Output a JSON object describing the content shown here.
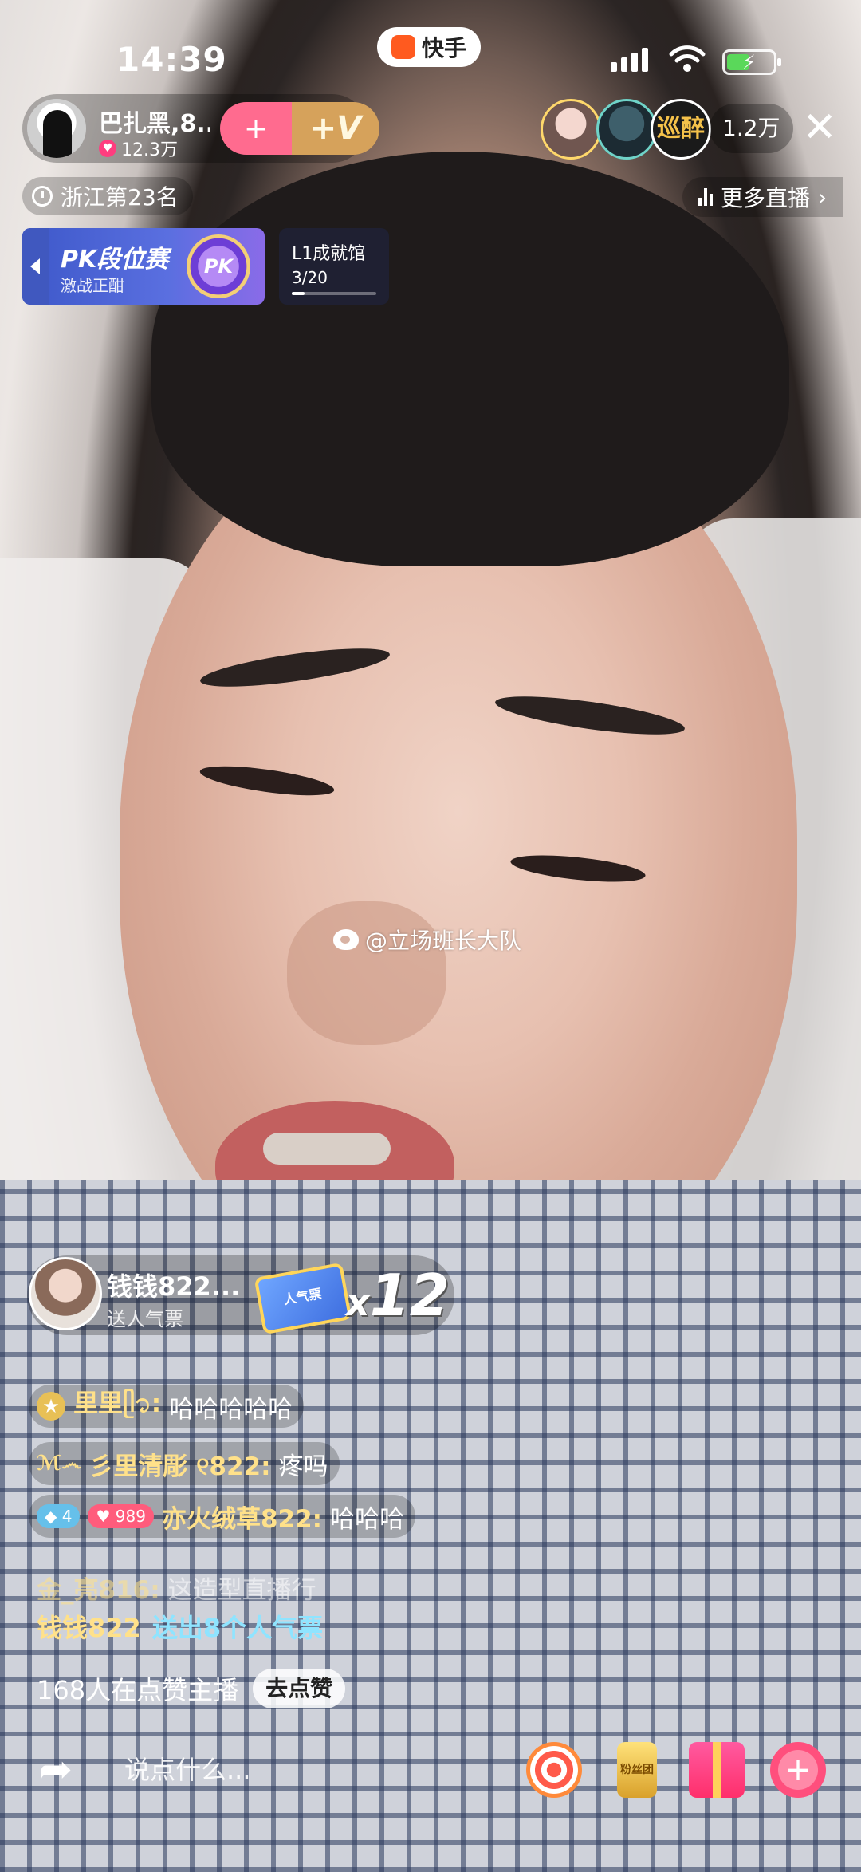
{
  "status_bar": {
    "time": "14:39",
    "app_name": "快手"
  },
  "host": {
    "name": "巴扎黑,8...",
    "likes": "12.3万"
  },
  "follow": {
    "plus": "+",
    "v": "+V"
  },
  "viewers": {
    "third_label": "巡醉",
    "count": "1.2万"
  },
  "close": "✕",
  "rank": {
    "label": "浙江第23名"
  },
  "more_live": {
    "label": "更多直播",
    "arrow": "›"
  },
  "pk_card": {
    "title": "PK段位赛",
    "subtitle": "激战正酣",
    "badge": "PK"
  },
  "achievement": {
    "title": "L1成就馆",
    "progress": "3/20",
    "fraction": 0.15
  },
  "watermark": {
    "text": "@立场班长大队"
  },
  "gift_banner": {
    "name": "钱钱822...",
    "action": "送人气票",
    "ticket": "人气票",
    "x": "x",
    "count": "12"
  },
  "chat": [
    {
      "name": "里里ᥫ᭡:",
      "message": "哈哈哈哈哈",
      "badge": "star"
    },
    {
      "prefix": "ℳ෴",
      "name": "彡里清彫 ୧822:",
      "message": "疼吗"
    },
    {
      "badge_diamond": "4",
      "badge_heart": "989",
      "name": "亦火绒草822:",
      "message": "哈哈哈"
    },
    {
      "name": "金_亮816:",
      "message": "这造型直播行"
    }
  ],
  "gift_line": {
    "name": "钱钱822",
    "message": "送出8个人气票"
  },
  "likes_line": {
    "text": "168人在点赞主播",
    "button": "去点赞"
  },
  "bottom_bar": {
    "placeholder": "说点什么...",
    "fan_label": "粉丝团"
  },
  "colors": {
    "accent_gold": "#ffe18a",
    "gift_cyan": "#8fe4ff",
    "kuaishou_orange": "#ff5a1f"
  }
}
